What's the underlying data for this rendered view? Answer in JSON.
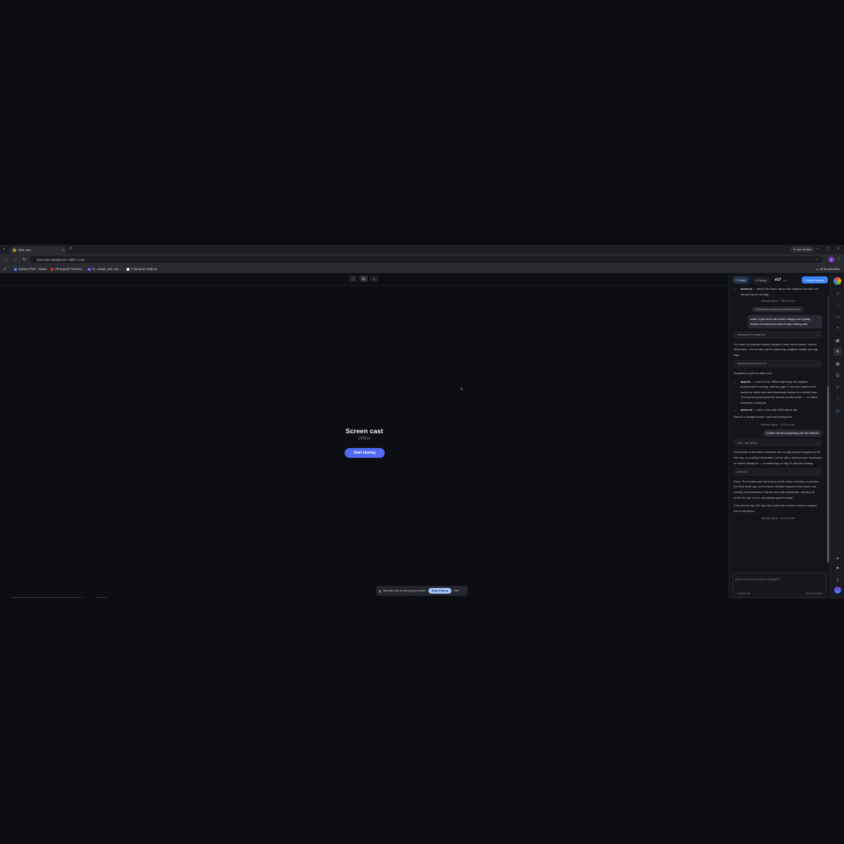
{
  "browser": {
    "tab_title": "vibe.cast",
    "tab_close": "×",
    "new_tab": "+",
    "gemini_label": "Ask Gemini",
    "url": "vibecode.cast/github/ • 8/file • cast",
    "profile_initial": "K",
    "bookmarks": [
      {
        "label": "Gdown PRH - Ridea",
        "color": "#4285f4"
      },
      {
        "label": "Threepoint Thanka...",
        "color": "#d93025"
      },
      {
        "label": "Cl, 4Jnak_v21 | da...",
        "color": "#9c4df4"
      },
      {
        "label": "7 Dynamic Widcos",
        "color": "#ffffff"
      }
    ],
    "all_bookmarks": "All Bookmarks"
  },
  "main": {
    "mode_buttons": [
      "▢",
      "⊡",
      "▯"
    ],
    "title": "Screen cast",
    "status": "Offline",
    "start_button": "Start sharing",
    "share_bar": {
      "message": "vibecode.com is sharing your screen",
      "stop": "Stop sharing",
      "hide": "Hide"
    }
  },
  "panel": {
    "tabs": [
      {
        "label": "Build",
        "icon": "✎"
      },
      {
        "label": "History",
        "icon": "⟲"
      }
    ],
    "version": "v17",
    "version_sub": "ver",
    "publish": "Publish Update",
    "messages": {
      "bullet_top": [
        "server.ts",
        "— raised the frame cap so the adaptive encoder can still get frames through."
      ],
      "agent_1": "Website Agent · 708 this turn",
      "chip_1": "Rolled back to previous working version",
      "user_1": "make it just send raw screen images and quality frames and stuff just make it cast nothing else",
      "file_1": "workspace/src/app.tsx",
      "text_1": "You want the planned session stripped down, send frames, receive, show them. Let me strip out the watchdog, adaptive quality, and lag logic.",
      "file_2": "workspace/src/server.ts",
      "text_2": "Simplified to just the plain cast:",
      "bullets": [
        [
          "app.tsx",
          "— removed the offline watchdog, the adaptive quality/scale encoding, and lag logic. It now just captures the screen at native size and broadcasts frames on a simple loop. The receiver just shows the frames as they arrive — no offline detection is doing its."
        ],
        [
          "server.ts",
          "— back to the plain WS4 frame cap."
        ]
      ],
      "text_3": "Now it's a straight screen cast and nothing else.",
      "agent_2": "Website Agent · 104 this turn",
      "user_2": "it does not send anything over the internet",
      "file_3": "cast · net debug",
      "text_4": "The frames at full native resolution are too big and get dropped by the size cap, so nothing broadcasts. Let me add a minimal auto downscale so frames always fit — no watchdog, no lag, it's still just casting.",
      "file_4": "server.ts",
      "text_5": "Fixed. The trouble was that frames at full native resolution exceeded the WS4 send cap, so the server silently dropped every frame and nothing was broadcast. Frames now auto-downscale until they fit under the cap, so the cast always goes through.",
      "text_6": "(The second day 404 log entry is just the browser's favicon request and is harmless.)",
      "agent_3": "Website Agent · 104 this turn"
    },
    "composer_placeholder": "What would you like to change?",
    "attach": "Attach file",
    "agent_select": "Website Agent"
  },
  "rail_icons": [
    "avatar-icon",
    "bell-icon",
    "heart-icon",
    "folder-icon",
    "star-icon",
    "image-icon",
    "wrench-icon",
    "grid-icon",
    "chat-icon",
    "user-icon",
    "more-icon",
    "sparkle-icon",
    "flag-icon",
    "book-icon",
    "gemini-icon"
  ],
  "colors": {
    "accent": "#4f6af0",
    "publish": "#3b82f6",
    "stop_sharing": "#a8c7fa"
  }
}
